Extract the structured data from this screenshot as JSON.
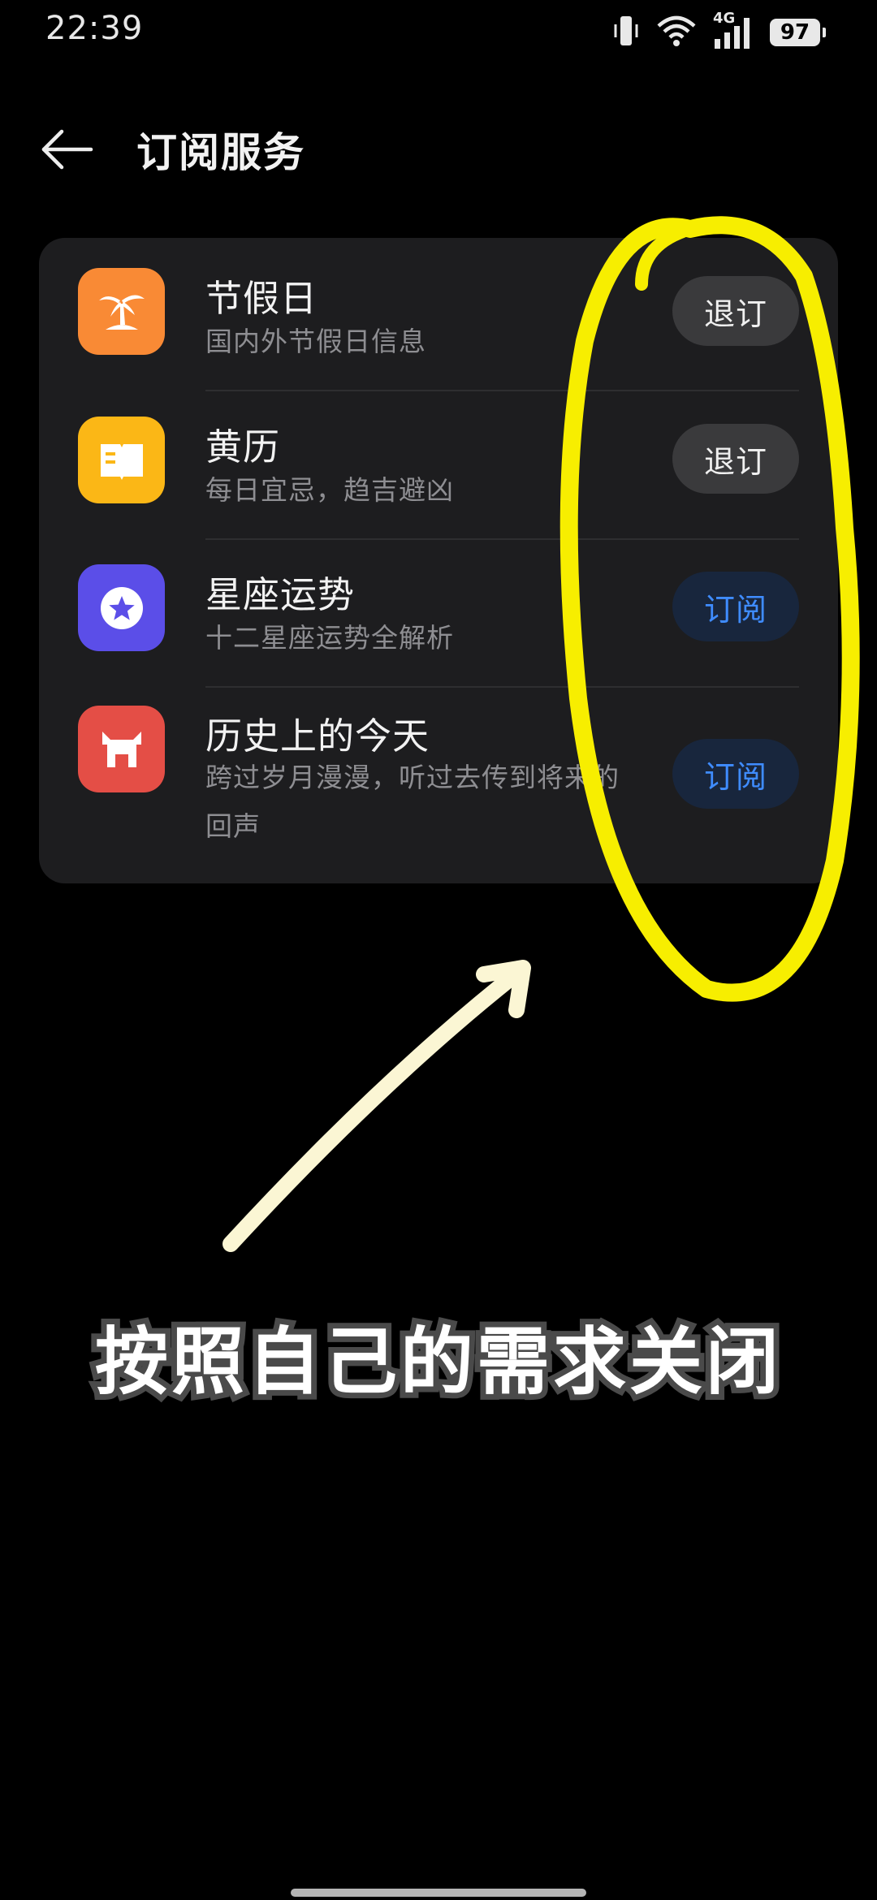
{
  "status_bar": {
    "time": "22:39",
    "network": "4G",
    "battery": "97"
  },
  "header": {
    "title": "订阅服务"
  },
  "services": [
    {
      "title": "节假日",
      "subtitle": "国内外节假日信息",
      "button": "退订",
      "state": "subscribed",
      "icon": "palm-tree-icon",
      "color": "#f98a35"
    },
    {
      "title": "黄历",
      "subtitle": "每日宜忌，趋吉避凶",
      "button": "退订",
      "state": "subscribed",
      "icon": "book-icon",
      "color": "#fbb716"
    },
    {
      "title": "星座运势",
      "subtitle": "十二星座运势全解析",
      "button": "订阅",
      "state": "unsubscribed",
      "icon": "star-badge-icon",
      "color": "#5b4ee8"
    },
    {
      "title": "历史上的今天",
      "subtitle": "跨过岁月漫漫，听过去传到将来的回声",
      "button": "订阅",
      "state": "unsubscribed",
      "icon": "history-gate-icon",
      "color": "#e44e46"
    }
  ],
  "annotation": {
    "text": "按照自己的需求关闭",
    "highlight_color": "#f7ee00",
    "arrow_color": "#fbf6d4"
  },
  "colors": {
    "background": "#000000",
    "card": "#1d1d1f",
    "unsubscribe_button": "#3a3a3c",
    "subscribe_button": "#18263d",
    "subscribe_text": "#3f8cff"
  }
}
